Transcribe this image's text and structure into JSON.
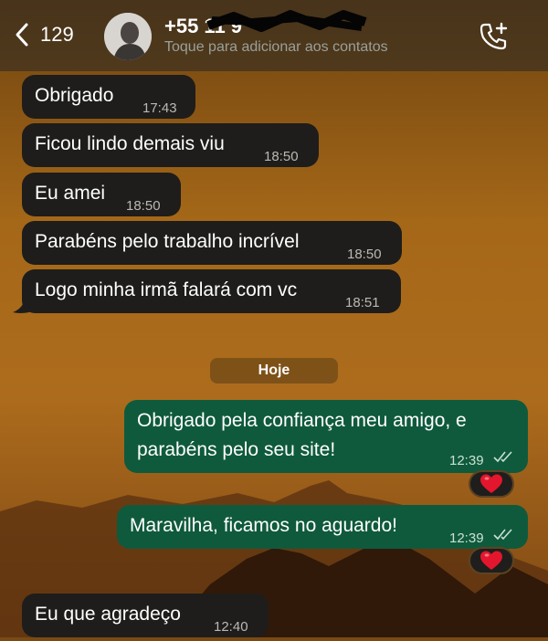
{
  "header": {
    "back_count": "129",
    "contact_name": "+55 11 9",
    "contact_subtitle": "Toque para adicionar aos contatos"
  },
  "messages": [
    {
      "direction": "in",
      "text": "Obrigado",
      "time": "17:43"
    },
    {
      "direction": "in",
      "text": "Ficou lindo demais viu",
      "time": "18:50"
    },
    {
      "direction": "in",
      "text": "Eu amei",
      "time": "18:50"
    },
    {
      "direction": "in",
      "text": "Parabéns pelo trabalho incrível",
      "time": "18:50"
    },
    {
      "direction": "in",
      "text": "Logo minha irmã falará com vc",
      "time": "18:51"
    },
    {
      "direction": "out",
      "text_line1": "Obrigado pela confiança meu amigo, e",
      "text_line2": "parabéns pelo seu site!",
      "time": "12:39",
      "reaction": "❤️"
    },
    {
      "direction": "out",
      "text": "Maravilha, ficamos no aguardo!",
      "time": "12:39",
      "reaction": "❤️"
    },
    {
      "direction": "in",
      "text": "Eu que agradeço",
      "time": "12:40"
    }
  ],
  "day_separator": "Hoje",
  "icons": [
    "chevron-left-icon",
    "avatar-photo",
    "add-call-icon",
    "double-check-icon",
    "heart-reaction-icon"
  ],
  "colors": {
    "incoming_bubble": "#1e1d1b",
    "outgoing_bubble": "#0f5a3c",
    "read_check": "#c9e0d3"
  }
}
